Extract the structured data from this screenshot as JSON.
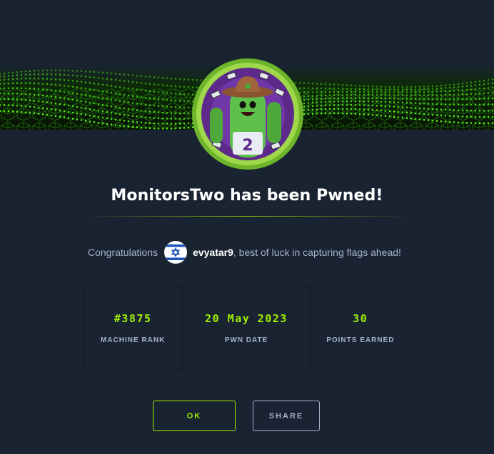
{
  "colors": {
    "background": "#1a2332",
    "accent": "#9fef00",
    "muted_text": "#a4b1cd",
    "heading": "#ffffff"
  },
  "banner": {
    "icon": "green-cube-grid-banner"
  },
  "machine": {
    "avatar_icon": "cactus-cowboy-avatar-icon",
    "title": "MonitorsTwo has been Pwned!"
  },
  "congrats": {
    "prefix": "Congratulations",
    "flag_icon": "israel-flag-icon",
    "username": "evyatar9",
    "suffix": ", best of luck in capturing flags ahead!"
  },
  "stats": [
    {
      "value": "#3875",
      "label": "MACHINE RANK"
    },
    {
      "value": "20 May 2023",
      "label": "PWN DATE"
    },
    {
      "value": "30",
      "label": "POINTS EARNED"
    }
  ],
  "buttons": {
    "ok": "OK",
    "share": "SHARE"
  }
}
